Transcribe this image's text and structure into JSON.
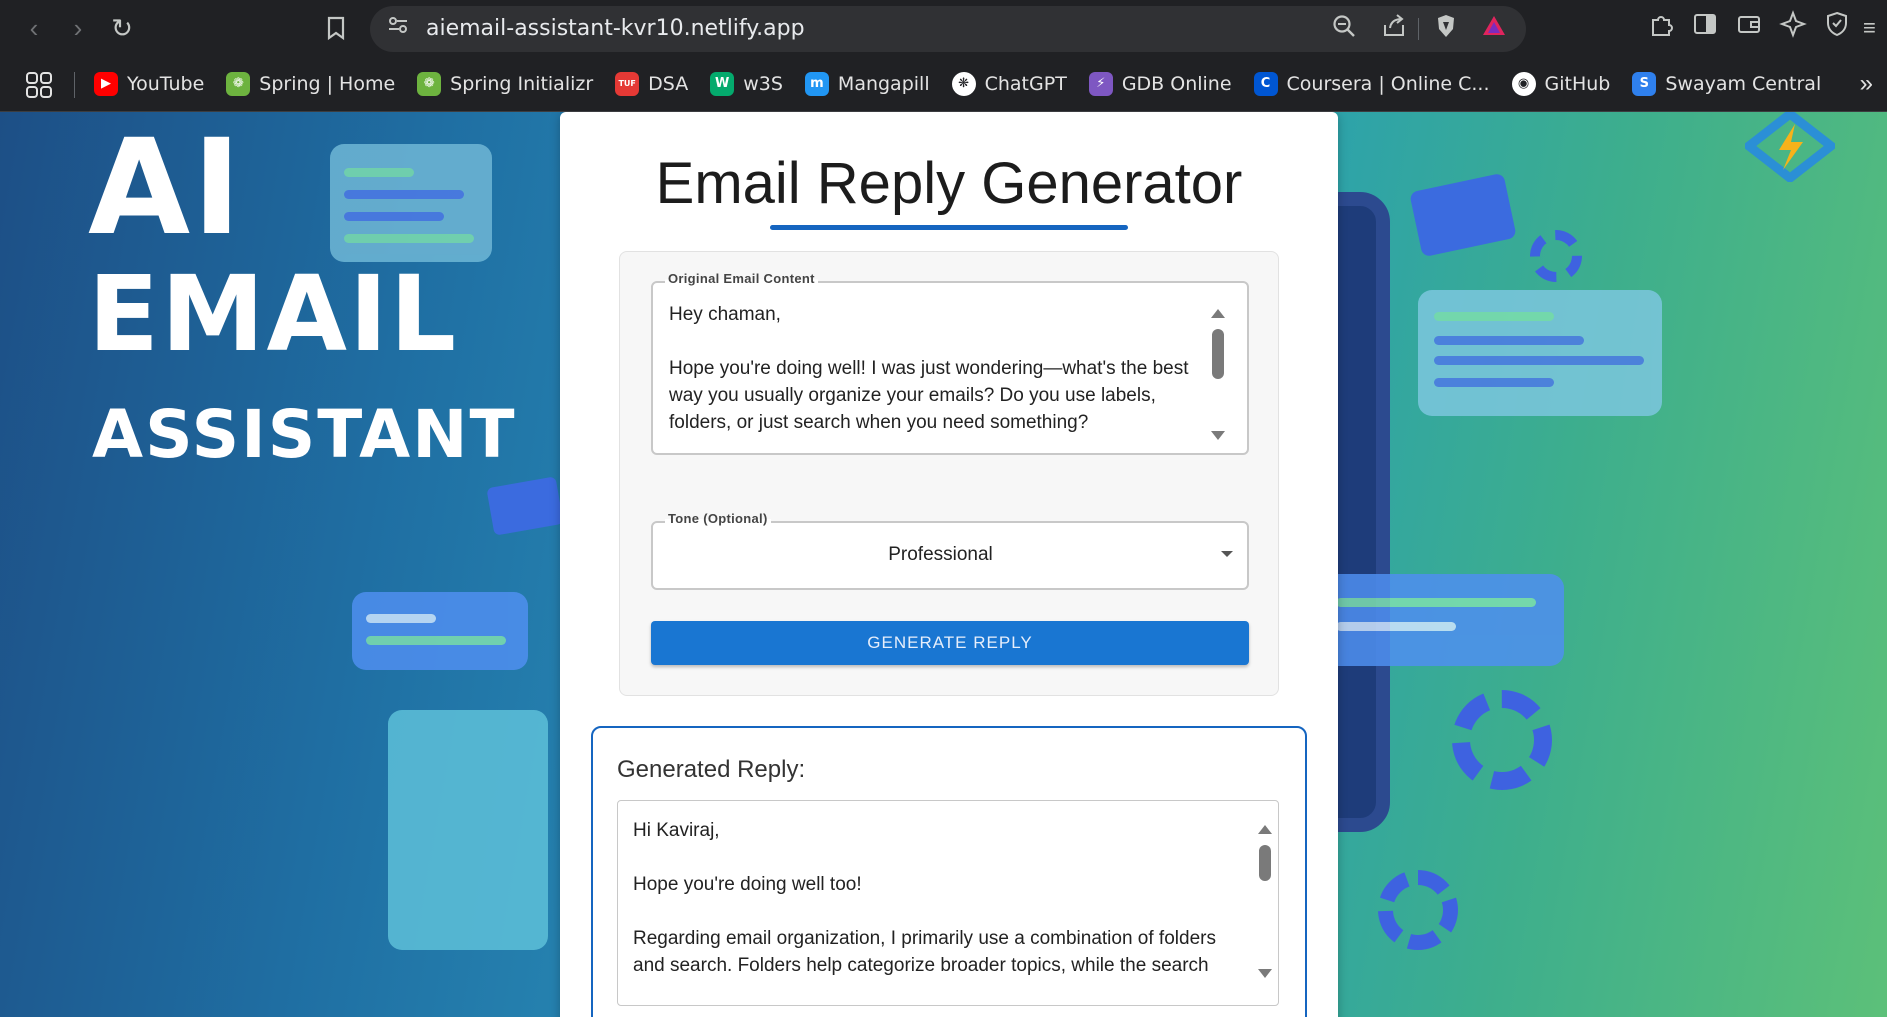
{
  "browser": {
    "url": "aiemail-assistant-kvr10.netlify.app",
    "bookmarks": [
      {
        "label": "YouTube",
        "icon": "youtube-icon",
        "color": "#ff0000"
      },
      {
        "label": "Spring | Home",
        "icon": "spring-icon",
        "color": "#6db33f"
      },
      {
        "label": "Spring Initializr",
        "icon": "spring-icon",
        "color": "#6db33f"
      },
      {
        "label": "DSA",
        "icon": "tuf-icon",
        "color": "#e53935"
      },
      {
        "label": "w3S",
        "icon": "w3schools-icon",
        "color": "#04aa6d"
      },
      {
        "label": "Mangapill",
        "icon": "mangapill-icon",
        "color": "#2196f3"
      },
      {
        "label": "ChatGPT",
        "icon": "chatgpt-icon",
        "color": "#ffffff"
      },
      {
        "label": "GDB Online",
        "icon": "gdb-icon",
        "color": "#7e57c2"
      },
      {
        "label": "Coursera | Online C...",
        "icon": "coursera-icon",
        "color": "#0056d2"
      },
      {
        "label": "GitHub",
        "icon": "github-icon",
        "color": "#ffffff"
      },
      {
        "label": "Swayam Central",
        "icon": "swayam-icon",
        "color": "#2f80ed"
      }
    ]
  },
  "background": {
    "line1": "AI",
    "line2": "EMAIL",
    "line3": "ASSISTANT"
  },
  "app": {
    "title": "Email Reply Generator",
    "email_field": {
      "label": "Original Email Content",
      "value": "Hey chaman,\n\nHope you're doing well! I was just wondering—what's the best way you usually organize your emails? Do you use labels, folders, or just search when you need something?"
    },
    "tone_field": {
      "label": "Tone (Optional)",
      "value": "Professional"
    },
    "generate_button": "GENERATE REPLY",
    "reply": {
      "heading": "Generated Reply:",
      "value": "Hi Kaviraj,\n\nHope you're doing well too!\n\nRegarding email organization, I primarily use a combination of folders and search. Folders help categorize broader topics, while the search"
    },
    "accent_color": "#1976d2"
  }
}
